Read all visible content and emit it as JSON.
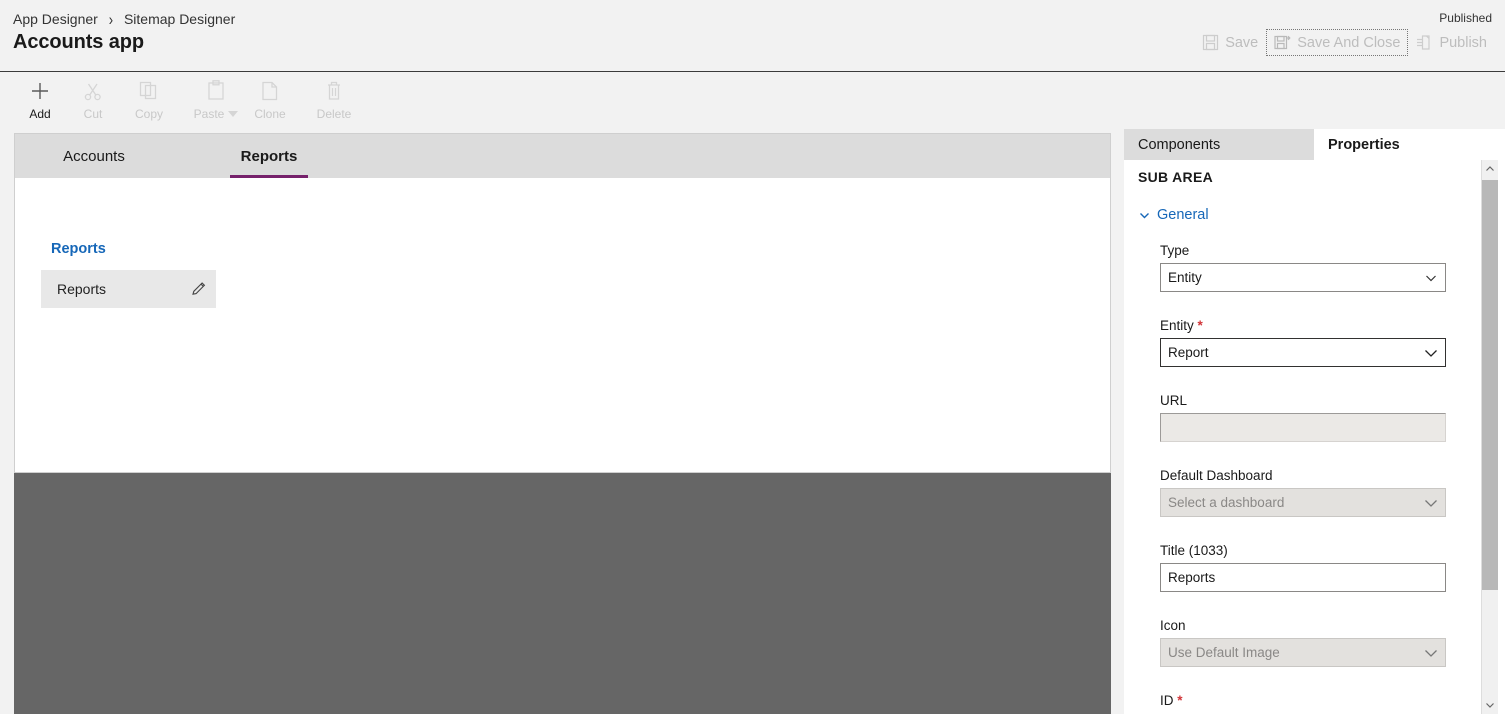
{
  "header": {
    "breadcrumb": {
      "parent": "App Designer",
      "separator": "›",
      "current": "Sitemap Designer"
    },
    "app_title": "Accounts app",
    "published_label": "Published",
    "actions": [
      {
        "label": "Save",
        "icon": "save-icon",
        "enabled": false,
        "focused": false
      },
      {
        "label": "Save And Close",
        "icon": "save-and-close-icon",
        "enabled": false,
        "focused": true
      },
      {
        "label": "Publish",
        "icon": "publish-icon",
        "enabled": false,
        "focused": false
      }
    ]
  },
  "commandbar": {
    "items": [
      {
        "label": "Add",
        "icon": "plus-icon",
        "enabled": true,
        "has_caret": false
      },
      {
        "label": "Cut",
        "icon": "scissors-icon",
        "enabled": false,
        "has_caret": false
      },
      {
        "label": "Copy",
        "icon": "copy-icon",
        "enabled": false,
        "has_caret": false
      },
      {
        "label": "Paste",
        "icon": "paste-icon",
        "enabled": false,
        "has_caret": true
      },
      {
        "label": "Clone",
        "icon": "clone-icon",
        "enabled": false,
        "has_caret": false
      },
      {
        "label": "Delete",
        "icon": "trash-icon",
        "enabled": false,
        "has_caret": false
      }
    ]
  },
  "canvas": {
    "tabs": [
      {
        "label": "Accounts",
        "active": false
      },
      {
        "label": "Reports",
        "active": true
      }
    ],
    "group_title": "Reports",
    "subarea_tile": {
      "label": "Reports",
      "edit_icon": "pencil-icon"
    },
    "accent_color": "#76216b"
  },
  "right_panel": {
    "tabs": [
      {
        "label": "Components",
        "active": false
      },
      {
        "label": "Properties",
        "active": true
      }
    ],
    "section_header": "SUB AREA",
    "general": {
      "label": "General",
      "expanded": true,
      "chevron_icon": "chevron-down-icon",
      "link_color": "#1667b8"
    },
    "fields": [
      {
        "name": "type",
        "label": "Type",
        "required": false,
        "control": "dropdown",
        "value": "Entity",
        "placeholder": "",
        "state": "normal"
      },
      {
        "name": "entity",
        "label": "Entity",
        "required": true,
        "control": "dropdown",
        "value": "Report",
        "placeholder": "",
        "state": "focused"
      },
      {
        "name": "url",
        "label": "URL",
        "required": false,
        "control": "text",
        "value": "",
        "placeholder": "",
        "state": "disabled"
      },
      {
        "name": "default-dashboard",
        "label": "Default Dashboard",
        "required": false,
        "control": "dropdown",
        "value": "",
        "placeholder": "Select a dashboard",
        "state": "dropdown-disabled"
      },
      {
        "name": "title",
        "label": "Title (1033)",
        "required": false,
        "control": "text",
        "value": "Reports",
        "placeholder": "",
        "state": "normal"
      },
      {
        "name": "icon",
        "label": "Icon",
        "required": false,
        "control": "dropdown",
        "value": "",
        "placeholder": "Use Default Image",
        "state": "dropdown-disabled"
      },
      {
        "name": "id",
        "label": "ID",
        "required": true,
        "control": "none",
        "value": "",
        "placeholder": "",
        "state": "normal"
      }
    ],
    "scrollbar": {
      "up_icon": "chevron-up-icon",
      "down_icon": "chevron-down-icon"
    }
  }
}
